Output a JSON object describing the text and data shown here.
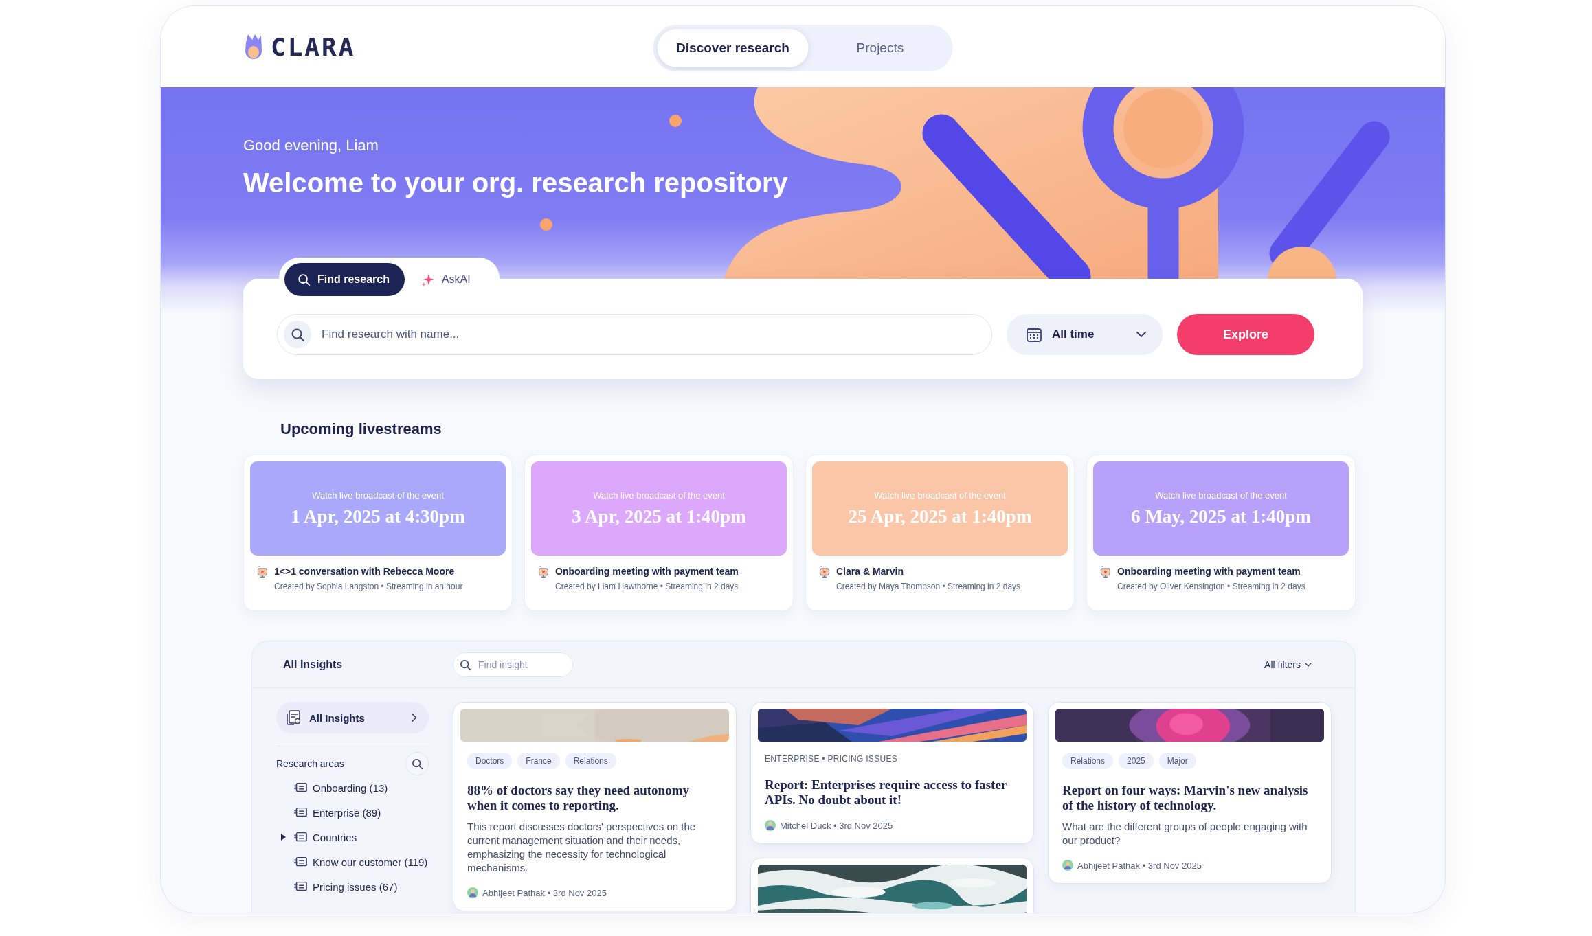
{
  "brand": {
    "name": "CLARA"
  },
  "nav": [
    {
      "label": "Discover research",
      "selected": true
    },
    {
      "label": "Projects",
      "selected": false
    }
  ],
  "hero": {
    "greeting": "Good evening, Liam",
    "title": "Welcome to your org. research repository"
  },
  "search": {
    "tabs": [
      {
        "label": "Find research",
        "kind": "search",
        "selected": true
      },
      {
        "label": "AskAI",
        "kind": "ai",
        "selected": false
      }
    ],
    "placeholder": "Find research with name...",
    "date_range": "All time",
    "button": "Explore"
  },
  "livestreams": {
    "title": "Upcoming livestreams",
    "items": [
      {
        "caption": "Watch live broadcast of the event",
        "date": "1 Apr, 2025 at 4:30pm",
        "title": "1<>1 conversation with Rebecca Moore",
        "meta": "Created by Sophia Langston • Streaming in an hour",
        "color": "#aaa8fb"
      },
      {
        "caption": "Watch live broadcast of the event",
        "date": "3 Apr, 2025 at 1:40pm",
        "title": "Onboarding meeting with payment team",
        "meta": "Created by Liam Hawthorne • Streaming in 2 days",
        "color": "#dca8fb"
      },
      {
        "caption": "Watch live broadcast of the event",
        "date": "25 Apr, 2025 at 1:40pm",
        "title": "Clara & Marvin",
        "meta": "Created by Maya Thompson • Streaming in 2 days",
        "color": "#fbc6a8"
      },
      {
        "caption": "Watch live broadcast of the event",
        "date": "6 May, 2025 at 1:40pm",
        "title": "Onboarding meeting with payment team",
        "meta": "Created by Oliver Kensington • Streaming in 2 days",
        "color": "#b7a1fa"
      }
    ]
  },
  "insights": {
    "title": "All Insights",
    "search_placeholder": "Find insight",
    "filters": "All filters",
    "sidebar": {
      "all_label": "All Insights",
      "section": "Research areas",
      "areas": [
        {
          "label": "Onboarding (13)",
          "kind": "leaf"
        },
        {
          "label": "Enterprise (89)",
          "kind": "leaf"
        },
        {
          "label": "Countries",
          "kind": "group",
          "expanded": false
        },
        {
          "label": "Know our customer (119)",
          "kind": "leaf"
        },
        {
          "label": "Pricing issues (67)",
          "kind": "leaf"
        }
      ]
    },
    "columns": [
      [
        {
          "kind": "tags",
          "tags": [
            "Doctors",
            "France",
            "Relations"
          ],
          "title": "88% of doctors say they need autonomy when it comes to reporting.",
          "summary": "This report discusses doctors' perspectives on the current management situation and their needs, emphasizing the necessity for technological mechanisms.",
          "byline": "Abhijeet Pathak • 3rd Nov 2025"
        }
      ],
      [
        {
          "kind": "category",
          "category": "ENTERPRISE • PRICING ISSUES",
          "title": "Report: Enterprises require access to faster APIs. No doubt about it!",
          "byline": "Mitchel Duck • 3rd Nov 2025"
        },
        {
          "kind": "picture"
        }
      ],
      [
        {
          "kind": "tags",
          "tags": [
            "Relations",
            "2025",
            "Major"
          ],
          "title": "Report on four ways: Marvin's new analysis of the history of technology.",
          "summary": "What are the different groups of people engaging with our product?",
          "byline": "Abhijeet Pathak • 3rd Nov 2025"
        }
      ]
    ]
  }
}
